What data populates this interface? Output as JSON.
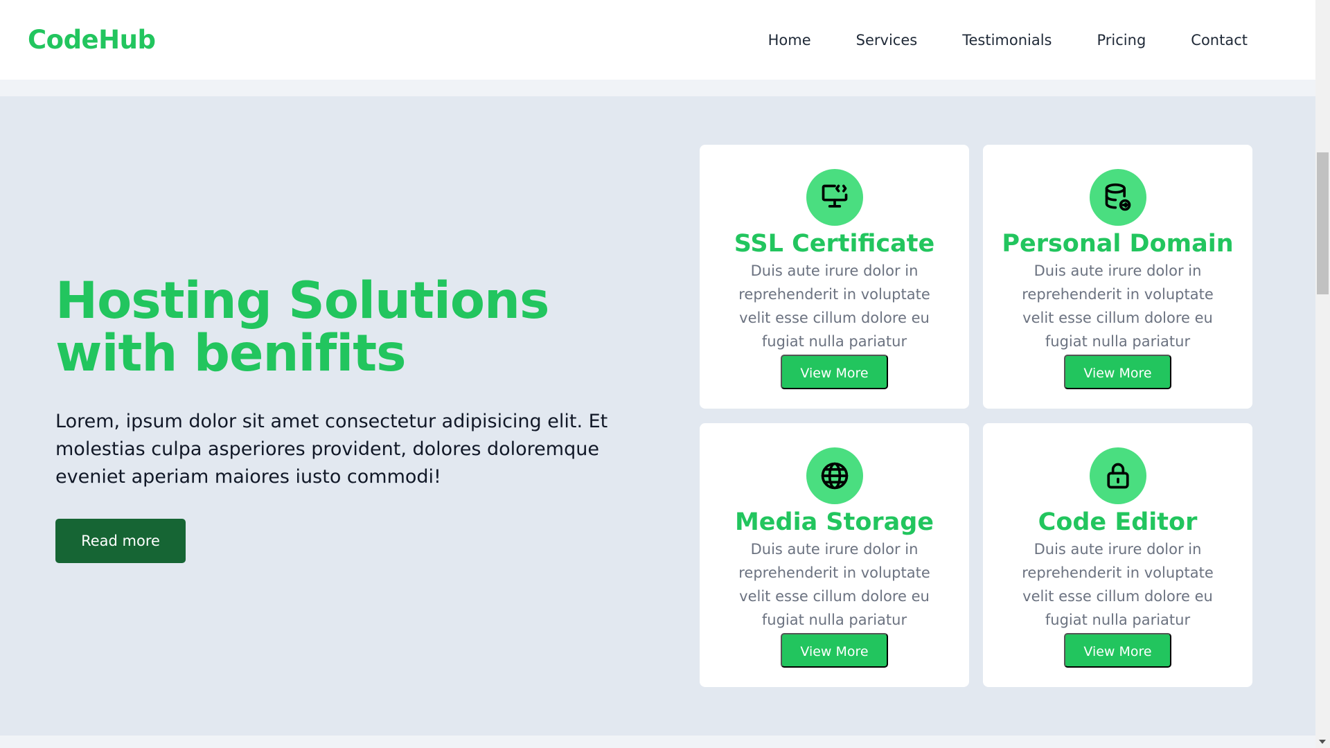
{
  "brand": {
    "name": "CodeHub",
    "color": "#22c55e"
  },
  "nav": {
    "items": [
      {
        "label": "Home"
      },
      {
        "label": "Services"
      },
      {
        "label": "Testimonials"
      },
      {
        "label": "Pricing"
      },
      {
        "label": "Contact"
      }
    ]
  },
  "hero": {
    "title": "Hosting Solutions with benifits",
    "text": "Lorem, ipsum dolor sit amet consectetur adipisicing elit. Et molestias culpa asperiores provident, dolores doloremque eveniet aperiam maiores iusto commodi!",
    "button_label": "Read more"
  },
  "cards": [
    {
      "icon": "monitor-code-icon",
      "title": "SSL Certificate",
      "text": "Duis aute irure dolor in reprehenderit in voluptate velit esse cillum dolore eu fugiat nulla pariatur",
      "button_label": "View More"
    },
    {
      "icon": "database-icon",
      "title": "Personal Domain",
      "text": "Duis aute irure dolor in reprehenderit in voluptate velit esse cillum dolore eu fugiat nulla pariatur",
      "button_label": "View More"
    },
    {
      "icon": "globe-icon",
      "title": "Media Storage",
      "text": "Duis aute irure dolor in reprehenderit in voluptate velit esse cillum dolore eu fugiat nulla pariatur",
      "button_label": "View More"
    },
    {
      "icon": "lock-icon",
      "title": "Code Editor",
      "text": "Duis aute irure dolor in reprehenderit in voluptate velit esse cillum dolore eu fugiat nulla pariatur",
      "button_label": "View More"
    }
  ],
  "colors": {
    "accent": "#22c55e",
    "icon_bg": "#4ade80",
    "dark_button": "#166534",
    "hero_bg": "#e2e8f0"
  }
}
